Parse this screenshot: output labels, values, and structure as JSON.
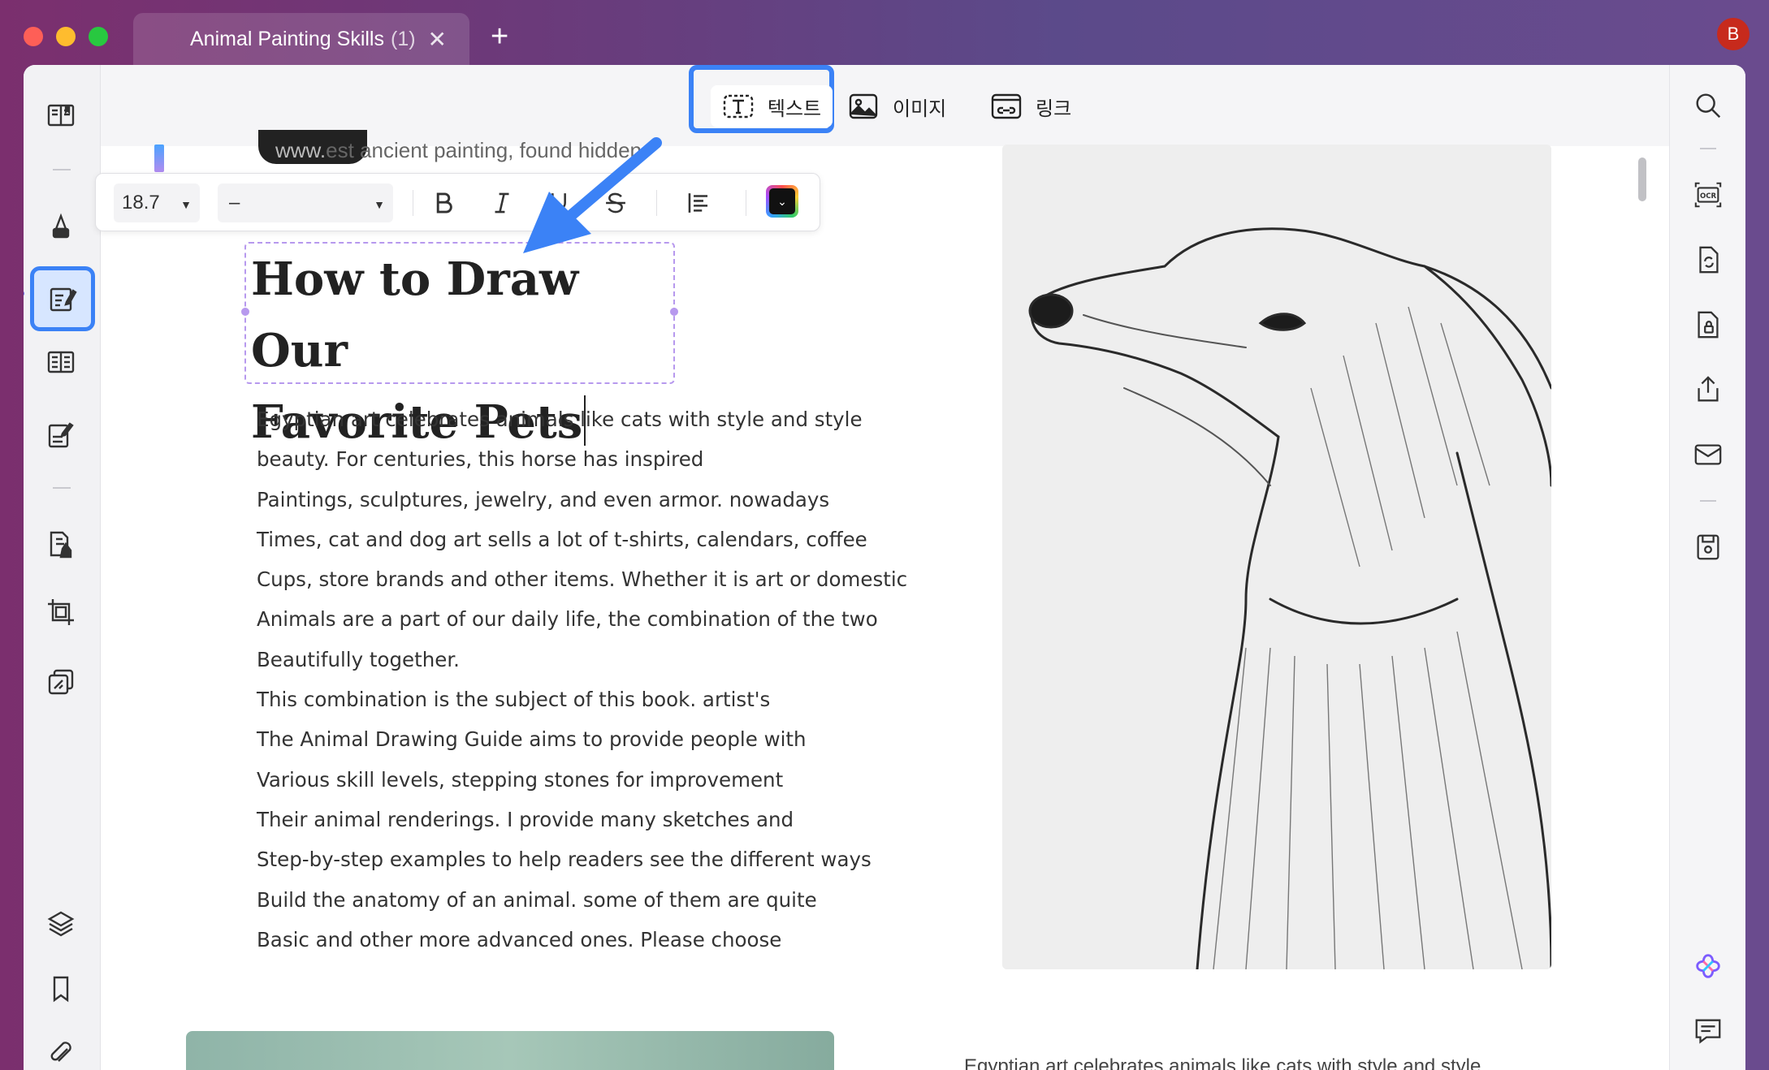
{
  "tab": {
    "title": "Animal Painting Skills",
    "count": "(1)",
    "close": "✕",
    "add": "+"
  },
  "avatar": {
    "initial": "B"
  },
  "colors": {
    "accent": "#3b82f6",
    "selection": "#b799ee",
    "avatar_bg": "#c72a1c"
  },
  "edit_toolbar": {
    "text_label": "텍스트",
    "image_label": "이미지",
    "link_label": "링크"
  },
  "format_toolbar": {
    "font_size": "18.7",
    "font_family": "–"
  },
  "document": {
    "header_line_prefix": "www.",
    "header_line": "est ancient painting, found hidden",
    "title_line1": "How to Draw Our",
    "title_line2": "Favorite Pets",
    "body_lines": [
      "Egyptian art celebrates animals like cats with style and style",
      "beauty. For centuries, this horse has inspired",
      "Paintings, sculptures, jewelry, and even armor. nowadays",
      "Times, cat and dog art sells a lot of t-shirts, calendars, coffee",
      "Cups, store brands and other items. Whether it is art or domestic",
      "Animals are a part of our daily life, the combination of the two",
      "Beautifully together.",
      "This combination is the subject of this book. artist's",
      "The Animal Drawing Guide aims to provide people with",
      "Various skill levels, stepping stones for improvement",
      "Their animal renderings. I provide many sketches and",
      "Step-by-step examples to help readers see the different ways",
      "Build the anatomy of an animal. some of them are quite",
      "Basic and other more advanced ones. Please choose"
    ],
    "bottom_right_line": "Egyptian art celebrates animals like cats with style and style"
  }
}
